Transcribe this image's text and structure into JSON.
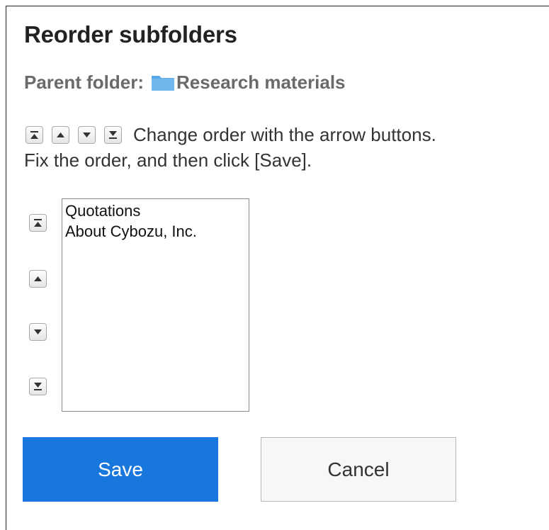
{
  "title": "Reorder subfolders",
  "parent": {
    "label": "Parent folder:",
    "folder_name": "Research materials",
    "folder_icon": "folder-icon",
    "folder_color": "#5aa9e6"
  },
  "instructions": {
    "line1": "Change order with the arrow buttons.",
    "line2": "Fix the order, and then click [Save]."
  },
  "order_buttons": [
    "move-top",
    "move-up",
    "move-down",
    "move-bottom"
  ],
  "subfolders": [
    "Quotations",
    "About Cybozu, Inc."
  ],
  "actions": {
    "save_label": "Save",
    "cancel_label": "Cancel",
    "save_color": "#1877dd"
  }
}
